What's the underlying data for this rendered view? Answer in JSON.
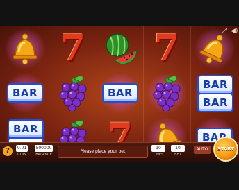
{
  "header": {
    "fullscreen_icon": "fullscreen-icon",
    "sound_icon": "speaker-icon"
  },
  "reels": [
    [
      "bell",
      "bar",
      "bar-double"
    ],
    [
      "seven",
      "grapes",
      "grapes"
    ],
    [
      "watermelon",
      "bar",
      "seven"
    ],
    [
      "seven",
      "grapes",
      "bell"
    ],
    [
      "bell",
      "bar-double",
      "bar"
    ]
  ],
  "symbols": {
    "bar_text": "BAR"
  },
  "controls": {
    "help_label": "?",
    "coin_value": "0.01",
    "coin_label": "COIN",
    "balance_value": "500000",
    "balance_label": "BALANCE",
    "message": "Please place your bet",
    "lines_value": "10",
    "lines_label": "LINES",
    "bet_value": "10",
    "bet_label": "BET",
    "auto_label": "AUTO",
    "start_label": "START"
  },
  "colors": {
    "accent": "#f59a14",
    "bar_blue": "#1f4fd8",
    "seven_red": "#e23a1c"
  }
}
